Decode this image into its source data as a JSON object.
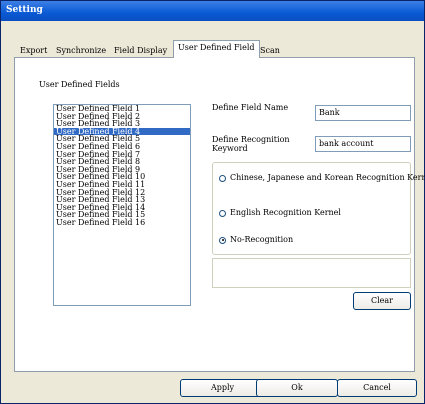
{
  "window": {
    "title": "Setting"
  },
  "tabs": [
    "Export",
    "Synchronize",
    "Field Display",
    "User Defined Field",
    "Scan"
  ],
  "active_tab": "User Defined Field",
  "user_defined": {
    "list_caption": "User Defined Fields",
    "fields": [
      "User Defined Field 1",
      "User Defined Field 2",
      "User Defined Field 3",
      "User Defined Field 4",
      "User Defined Field 5",
      "User Defined Field 6",
      "User Defined Field 7",
      "User Defined Field 8",
      "User Defined Field 9",
      "User Defined Field 10",
      "User Defined Field 11",
      "User Defined Field 12",
      "User Defined Field 13",
      "User Defined Field 14",
      "User Defined Field 15",
      "User Defined Field 16"
    ],
    "selected_field": "User Defined Field 4",
    "define_field_name_label": "Define Field Name",
    "define_field_name_value": "Bank",
    "define_keyword_label_line1": "Define Recognition",
    "define_keyword_label_line2": "Keyword",
    "define_keyword_value": "bank account",
    "recognition_options": [
      "Chinese, Japanese and Korean Recognition Kernel",
      "English Recognition Kernel",
      "No-Recognition"
    ],
    "selected_recognition": "No-Recognition",
    "clear_label": "Clear"
  },
  "buttons": {
    "apply": "Apply",
    "ok": "Ok",
    "cancel": "Cancel"
  }
}
